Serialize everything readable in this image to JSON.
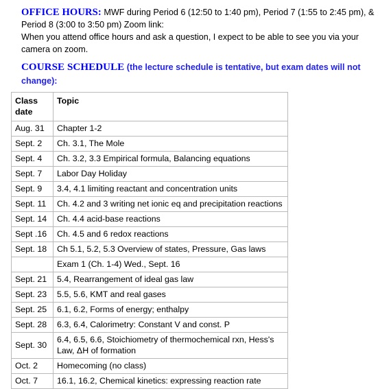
{
  "office_hours": {
    "label": "OFFICE HOURS:",
    "line1_rest": " MWF during Period 6 (12:50 to 1:40 pm), Period 7 (1:55 to 2:45 pm), &",
    "line2": "Period 8 (3:00 to 3:50 pm) Zoom link:",
    "note": "When you attend office hours and ask a question, I expect to be able to see you via your camera on zoom."
  },
  "course_schedule_heading": {
    "title": "COURSE SCHEDULE",
    "subtitle": " (the lecture schedule is tentative, but exam dates will not change):"
  },
  "table": {
    "columns": [
      "Class date",
      "Topic"
    ],
    "col_header_date_line1": "Class",
    "col_header_date_line2": "date",
    "col_header_topic": "Topic",
    "rows": [
      {
        "date": "Aug. 31",
        "topic": "Chapter 1-2",
        "style": "normal"
      },
      {
        "date": "Sept. 2",
        "topic": "Ch. 3.1, The Mole",
        "style": "normal"
      },
      {
        "date": "Sept. 4",
        "topic": "Ch. 3.2, 3.3 Empirical formula, Balancing equations",
        "style": "normal"
      },
      {
        "date": "Sept. 7",
        "topic": "Labor Day Holiday",
        "style": "green"
      },
      {
        "date": "Sept. 9",
        "topic": "3.4, 4.1 limiting reactant and concentration units",
        "style": "normal"
      },
      {
        "date": "Sept. 11",
        "topic": "Ch. 4.2 and 3 writing net ionic eq and precipitation reactions",
        "style": "normal"
      },
      {
        "date": "Sept. 14",
        "topic": "Ch. 4.4 acid-base reactions",
        "style": "normal"
      },
      {
        "date": "Sept .16",
        "topic": "Ch. 4.5 and 6 redox reactions",
        "style": "normal"
      },
      {
        "date": "Sept. 18",
        "topic": "Ch 5.1, 5.2, 5.3 Overview of states, Pressure, Gas laws",
        "style": "normal"
      },
      {
        "date": "",
        "topic": "Exam 1 (Ch. 1-4) Wed., Sept. 16",
        "style": "red"
      },
      {
        "date": "Sept. 21",
        "topic": "5.4, Rearrangement of ideal gas law",
        "style": "normal"
      },
      {
        "date": "Sept. 23",
        "topic": "5.5, 5.6, KMT and real gases",
        "style": "normal"
      },
      {
        "date": "Sept. 25",
        "topic": "6.1, 6.2, Forms of energy; enthalpy",
        "style": "normal"
      },
      {
        "date": "Sept. 28",
        "topic": "6.3, 6.4, Calorimetry: Constant V and const. P",
        "style": "normal"
      },
      {
        "date": "Sept. 30",
        "topic": "6.4, 6.5, 6.6, Stoichiometry of thermochemical rxn, Hess's Law, ΔH of formation",
        "style": "normal"
      },
      {
        "date": "Oct. 2",
        "topic": "Homecoming (no class)",
        "style": "green"
      },
      {
        "date": "Oct. 7",
        "topic": "16.1, 16.2, Chemical kinetics: expressing reaction rate",
        "style": "normal"
      }
    ]
  },
  "colors": {
    "heading_blue": "#0000ff",
    "holiday_green": "#00a550",
    "exam_red": "#f1100d",
    "table_border": "#b9b9b9",
    "text_black": "#000000",
    "page_background": "#ffffff"
  }
}
